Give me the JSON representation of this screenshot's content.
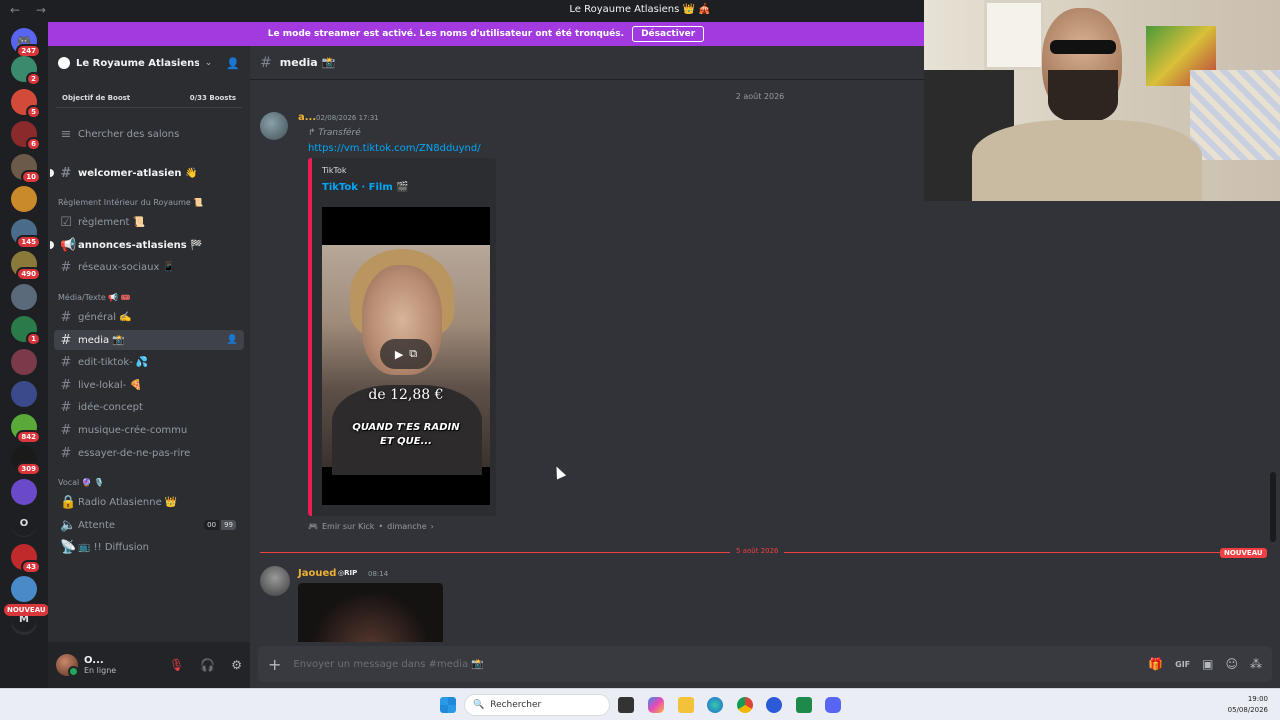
{
  "window": {
    "title": "Le Royaume Atlasiens 👑 🎪",
    "nav_arrows": "← →"
  },
  "banner": {
    "text": "Le mode streamer est activé. Les noms d'utilisateur ont été tronqués.",
    "button": "Désactiver"
  },
  "rail": {
    "servers": [
      {
        "badge": "247",
        "color": "#5865f2"
      },
      {
        "badge": "2",
        "color": "#3b8a6e"
      },
      {
        "badge": "5",
        "color": "#d44a3a"
      },
      {
        "badge": "6",
        "color": "#8a2a2a"
      },
      {
        "badge": "10",
        "color": "#6b5a4a"
      },
      {
        "badge": "",
        "color": "#c98a2a"
      },
      {
        "badge": "145",
        "color": "#4a6b8a"
      },
      {
        "badge": "490",
        "color": "#8a7a3a"
      },
      {
        "badge": "",
        "color": "#5a6a7a"
      },
      {
        "badge": "1",
        "color": "#2a7a4a"
      },
      {
        "badge": "",
        "color": "#7a3a4a"
      },
      {
        "badge": "",
        "color": "#3a4a8a"
      },
      {
        "badge": "842",
        "color": "#5aaa3a"
      },
      {
        "badge": "309",
        "color": "#1a1a1a"
      },
      {
        "badge": "",
        "color": "#6a4ac9"
      },
      {
        "badge": "",
        "color": "#2b2d31"
      },
      {
        "badge": "43",
        "color": "#c02a2a"
      },
      {
        "badge": "",
        "color": "#4a8ac9"
      },
      {
        "badge": "",
        "color": "#2b2d31"
      }
    ],
    "letters": [
      "O",
      "M"
    ],
    "new_label": "NOUVEAU"
  },
  "guild": {
    "name": "Le Royaume Atlasiens ...",
    "boost_label": "Objectif de Boost",
    "boost_count": "0/33 Boosts",
    "search_channels": "Chercher des salons"
  },
  "channels": {
    "welcome": "welcomer-atlasien 👋",
    "cat1": "Règlement Intérieur du Royaume 📜",
    "reglement": "règlement 📜",
    "annonces": "annonces-atlasiens 🏁",
    "reseaux": "réseaux-sociaux 📱",
    "cat2": "Média/Texte 📢 🎟️",
    "general": "général ✍️",
    "media": "media 📸",
    "edit": "edit-tiktok- 💦",
    "live": "live-lokal- 🍕",
    "idee": "idée-concept",
    "musique": "musique-crée-commu",
    "essayer": "essayer-de-ne-pas-rire",
    "cat3": "Vocal 🔮 🎙️",
    "radio": "Radio Atlasienne 👑",
    "attente": "Attente",
    "attente_count_a": "00",
    "attente_count_b": "99",
    "diffusion": "📺 !! Diffusion"
  },
  "user": {
    "name": "O...",
    "status": "En ligne"
  },
  "chat": {
    "channel": "media 📸",
    "date1": "2 août 2026",
    "msg1": {
      "author": "a...",
      "time": "02/08/2026 17:31",
      "forwarded": "Transféré",
      "link": "https://vm.tiktok.com/ZN8dduynd/",
      "embed_provider": "TikTok",
      "embed_title": "TikTok · Film 🎬",
      "video_price": "de 12,88 €",
      "video_caption_1": "QUAND T'ES RADIN",
      "video_caption_2": "ET QUE...",
      "source": "Emir sur Kick",
      "source_time": "dimanche"
    },
    "date2": "5 août 2026",
    "new_badge": "NOUVEAU",
    "msg2": {
      "author": "Jaoued",
      "tag": "RIP",
      "time": "08:14"
    },
    "placeholder": "Envoyer un message dans #media 📸"
  },
  "taskbar": {
    "search": "Rechercher",
    "time": "19:00",
    "date": "05/08/2026"
  },
  "colors": {
    "banner": "#a23ae0",
    "accent_link": "#00a8fc",
    "author_gold": "#f0b232",
    "new_red": "#f23f43"
  }
}
